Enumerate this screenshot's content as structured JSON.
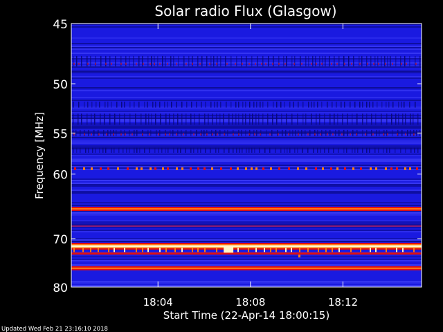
{
  "chart_data": {
    "type": "heatmap",
    "title": "Solar radio Flux (Glasgow)",
    "xlabel": "Start Time (22-Apr-14 18:00:15)",
    "ylabel": "Frequency [MHz]",
    "footer": "Updated Wed Feb 21 23:16:10 2018",
    "x_ticks": [
      "18:04",
      "18:08",
      "18:12"
    ],
    "x_tick_minutes": [
      4,
      8,
      12
    ],
    "x_range_minutes": [
      0.25,
      15.4
    ],
    "y_ticks": [
      45,
      50,
      55,
      60,
      70,
      80
    ],
    "y_range_mhz": [
      45,
      80
    ],
    "y_scale": "reciprocal",
    "colors": {
      "background": "#1a1ae0",
      "band_dark": "#08087a",
      "band_light": "#4a4aff",
      "hot_red": "#e01010",
      "hot_orange": "#ff7a10",
      "hot_white": "#fff6c8"
    },
    "emission_lines": [
      {
        "freq_mhz": 59.3,
        "intensity": "dashed-orange"
      },
      {
        "freq_mhz": 65.0,
        "intensity": "strong"
      },
      {
        "freq_mhz": 67.8,
        "intensity": "weak"
      },
      {
        "freq_mhz": 71.4,
        "intensity": "very-strong"
      },
      {
        "freq_mhz": 72.1,
        "intensity": "bursts"
      },
      {
        "freq_mhz": 72.8,
        "intensity": "medium"
      },
      {
        "freq_mhz": 75.8,
        "intensity": "strong"
      }
    ]
  }
}
